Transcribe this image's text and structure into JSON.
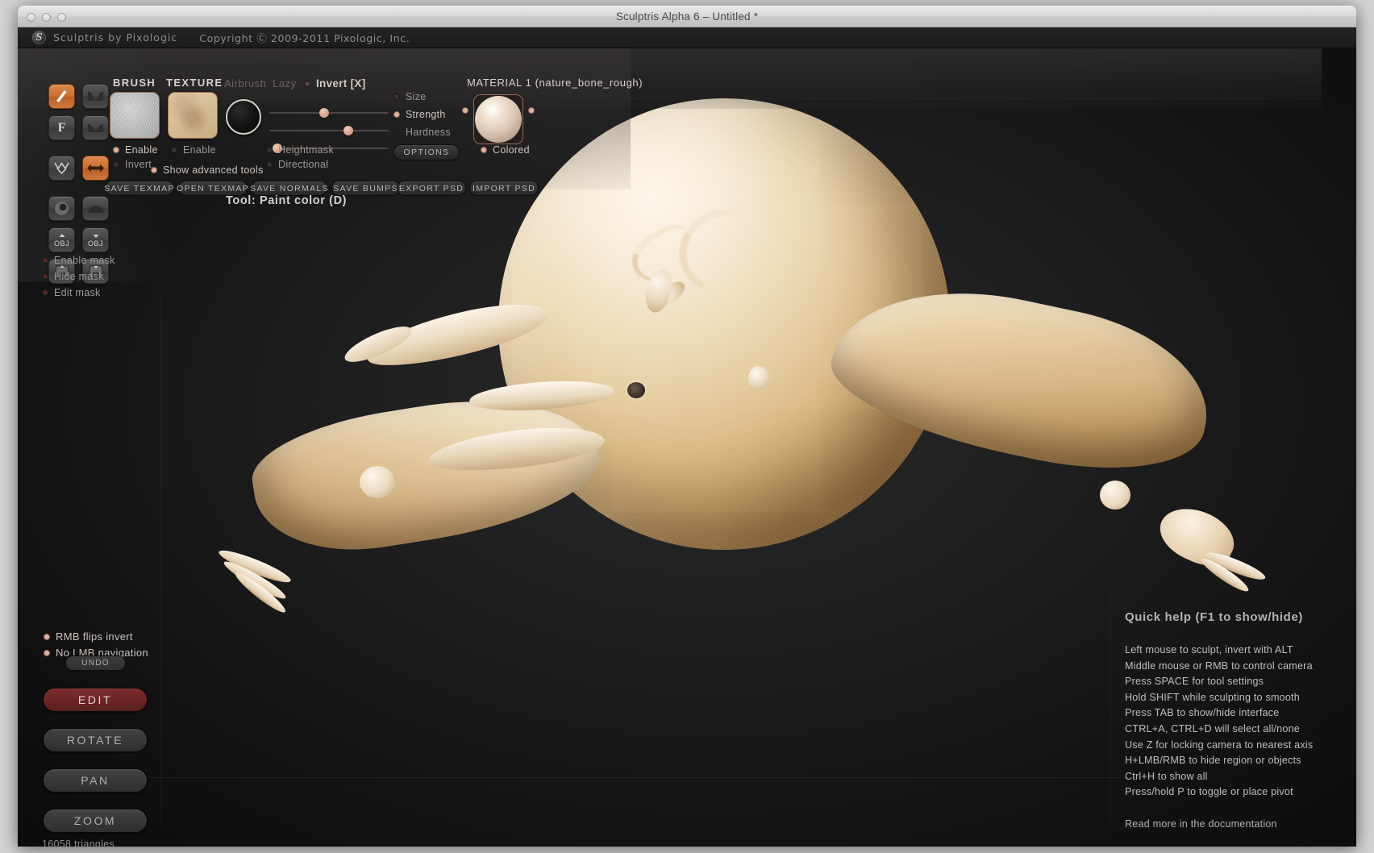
{
  "window": {
    "title": "Sculptris Alpha 6 – Untitled *",
    "traffic_lights": [
      "close",
      "minimize",
      "zoom"
    ]
  },
  "appheader": {
    "logo": "sculptris-logo-icon",
    "app_name": "Sculptris by Pixologic",
    "copyright": "Copyright Ⓒ 2009-2011 Pixologic, Inc."
  },
  "toolbar": {
    "buttons": [
      {
        "name": "brush-paint-tool",
        "icon": "brush-stroke-icon",
        "active": true
      },
      {
        "name": "crease-tool",
        "icon": "crease-icon",
        "active": false
      },
      {
        "name": "flatten-tool",
        "icon": "flatten-F-icon",
        "label": "F",
        "active": false
      },
      {
        "name": "smooth-tool",
        "icon": "smooth-curve-icon",
        "active": false
      },
      {
        "name": "pinch-tool",
        "icon": "pinch-w-icon",
        "active": false
      },
      {
        "name": "symmetry-tool",
        "icon": "double-arrow-icon",
        "active": true
      },
      {
        "name": "sphere-brush-tool",
        "icon": "sphere-icon",
        "active": false
      },
      {
        "name": "dome-brush-tool",
        "icon": "dome-icon",
        "active": false
      },
      {
        "name": "import-obj",
        "icon": "obj-up-icon",
        "label": "OBJ",
        "active": false
      },
      {
        "name": "export-obj",
        "icon": "obj-down-icon",
        "label": "OBJ",
        "active": false
      },
      {
        "name": "open-scene",
        "icon": "floppy-open-icon",
        "active": false
      },
      {
        "name": "save-scene",
        "icon": "floppy-save-icon",
        "active": false
      }
    ]
  },
  "brush_panel": {
    "label": "BRUSH",
    "swatch": "grey-noise-texture",
    "enable_label": "Enable",
    "enable_on": true,
    "invert_label": "Invert",
    "invert_on": false
  },
  "texture_panel": {
    "label": "TEXTURE",
    "swatch": "skin-texture",
    "enable_label": "Enable",
    "enable_on": false
  },
  "mode_toggles": {
    "airbrush_label": "Airbrush",
    "airbrush_on": false,
    "lazy_label": "Lazy",
    "lazy_on": false,
    "invert_label": "Invert [X]",
    "invert_on": false
  },
  "advanced": {
    "show_advanced_label": "Show advanced tools",
    "show_advanced_on": true
  },
  "sliders": [
    {
      "name": "size-slider",
      "label": "Size",
      "value": 45,
      "lit": false
    },
    {
      "name": "strength-slider",
      "label": "Strength",
      "value": 65,
      "lit": true
    },
    {
      "name": "hardness-slider",
      "label": "Hardness",
      "value": 6,
      "lit": false
    }
  ],
  "brush_options": {
    "heightmask_label": "Heightmask",
    "heightmask_on": false,
    "directional_label": "Directional",
    "directional_on": false,
    "options_button": "OPTIONS"
  },
  "material": {
    "title": "MATERIAL 1 (nature_bone_rough)",
    "preview": "material-sphere-preview",
    "colored_label": "Colored",
    "colored_on": true
  },
  "file_buttons": [
    {
      "name": "save-texmap-button",
      "label": "SAVE TEXMAP"
    },
    {
      "name": "open-texmap-button",
      "label": "OPEN TEXMAP"
    },
    {
      "name": "save-normals-button",
      "label": "SAVE NORMALS"
    },
    {
      "name": "save-bumps-button",
      "label": "SAVE BUMPS"
    },
    {
      "name": "export-psd-button",
      "label": "EXPORT PSD"
    },
    {
      "name": "import-psd-button",
      "label": "IMPORT PSD"
    }
  ],
  "tool_status": "Tool: Paint color (D)",
  "mask_options": [
    {
      "name": "enable-mask-toggle",
      "label": "Enable mask",
      "on": false
    },
    {
      "name": "hide-mask-toggle",
      "label": "Hide mask",
      "on": false
    },
    {
      "name": "edit-mask-toggle",
      "label": "Edit mask",
      "on": false
    }
  ],
  "mouse_options": [
    {
      "name": "rmb-flips-invert-toggle",
      "label": "RMB flips invert",
      "on": true
    },
    {
      "name": "no-lmb-navigation-toggle",
      "label": "No LMB navigation",
      "on": true
    }
  ],
  "nav": {
    "undo_label": "UNDO",
    "buttons": [
      {
        "name": "edit-mode-button",
        "label": "EDIT",
        "active": true
      },
      {
        "name": "rotate-mode-button",
        "label": "ROTATE",
        "active": false
      },
      {
        "name": "pan-mode-button",
        "label": "PAN",
        "active": false
      },
      {
        "name": "zoom-mode-button",
        "label": "ZOOM",
        "active": false
      }
    ]
  },
  "status": {
    "triangles": "16058 triangles"
  },
  "quick_help": {
    "title": "Quick help (F1 to show/hide)",
    "lines": [
      "Left mouse to sculpt, invert with ALT",
      "Middle mouse or RMB to control camera",
      "Press SPACE for tool settings",
      "Hold SHIFT while sculpting to smooth",
      "Press TAB to show/hide interface",
      "CTRL+A, CTRL+D will select all/none",
      "Use Z for locking camera to nearest axis",
      "H+LMB/RMB to hide region or objects",
      "Ctrl+H to show all",
      "Press/hold P to toggle or place pivot"
    ],
    "footer": "Read more in the documentation"
  },
  "viewport": {
    "name": "3d-viewport",
    "model": "organic-sculpt-creature"
  },
  "colors": {
    "accent_orange": "#c96f33",
    "edit_red": "#6a2424",
    "panel_bg": "#1d1d1e",
    "text": "#b9b4b0"
  }
}
